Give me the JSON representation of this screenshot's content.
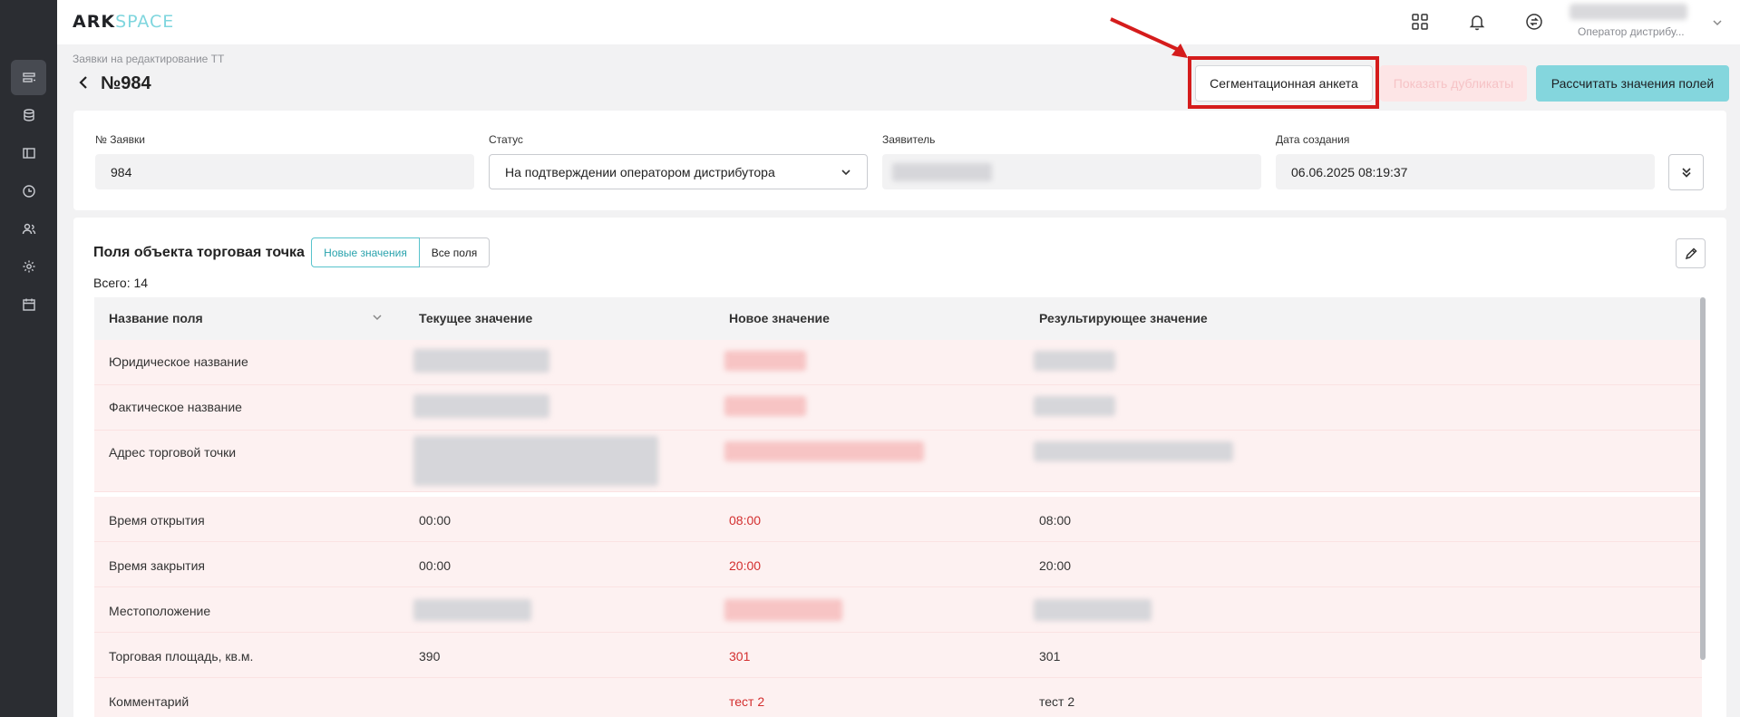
{
  "app": {
    "logo_ark": "ARK",
    "logo_space": "SPACE"
  },
  "sidebar": {
    "items": [
      {
        "icon": "requests-icon"
      },
      {
        "icon": "database-icon"
      },
      {
        "icon": "book-icon"
      },
      {
        "icon": "clock-icon"
      },
      {
        "icon": "users-icon"
      },
      {
        "icon": "settings-icon"
      },
      {
        "icon": "calendar-icon"
      }
    ]
  },
  "topbar": {
    "icons": [
      "apps-grid-icon",
      "bell-icon",
      "sync-icon"
    ],
    "user_role": "Оператор дистрибу..."
  },
  "header": {
    "breadcrumb": "Заявки на редактирование ТТ",
    "title": "№984",
    "buttons": {
      "segmentation": "Сегментационная анкета",
      "duplicates": "Показать дубликаты",
      "calculate": "Рассчитать значения полей"
    }
  },
  "info": {
    "request_no_label": "№ Заявки",
    "request_no_value": "984",
    "status_label": "Статус",
    "status_value": "На подтверждении оператором дистрибутора",
    "applicant_label": "Заявитель",
    "created_label": "Дата создания",
    "created_value": "06.06.2025 08:19:37"
  },
  "fields_section": {
    "title": "Поля объекта торговая точка",
    "toggle_new": "Новые значения",
    "toggle_all": "Все поля",
    "total": "Всего: 14",
    "columns": [
      "Название поля",
      "Текущее значение",
      "Новое значение",
      "Результирующее значение"
    ],
    "rows": [
      {
        "name": "Юридическое название",
        "current": "",
        "new": "",
        "result": ""
      },
      {
        "name": "Фактическое название",
        "current": "",
        "new": "",
        "result": ""
      },
      {
        "name": "Адрес торговой точки",
        "current": "",
        "new": "",
        "result": ""
      },
      {
        "name": "Время открытия",
        "current": "00:00",
        "new": "08:00",
        "result": "08:00"
      },
      {
        "name": "Время закрытия",
        "current": "00:00",
        "new": "20:00",
        "result": "20:00"
      },
      {
        "name": "Местоположение",
        "current": "",
        "new": "",
        "result": ""
      },
      {
        "name": "Торговая площадь, кв.м.",
        "current": "390",
        "new": "301",
        "result": "301"
      },
      {
        "name": "Комментарий",
        "current": "",
        "new": "тест 2",
        "result": "тест 2"
      }
    ]
  },
  "colors": {
    "accent": "#84d6dd",
    "highlight": "#d51c1c",
    "row_bg": "#fdf1f1",
    "new_value": "#d32f2f"
  }
}
